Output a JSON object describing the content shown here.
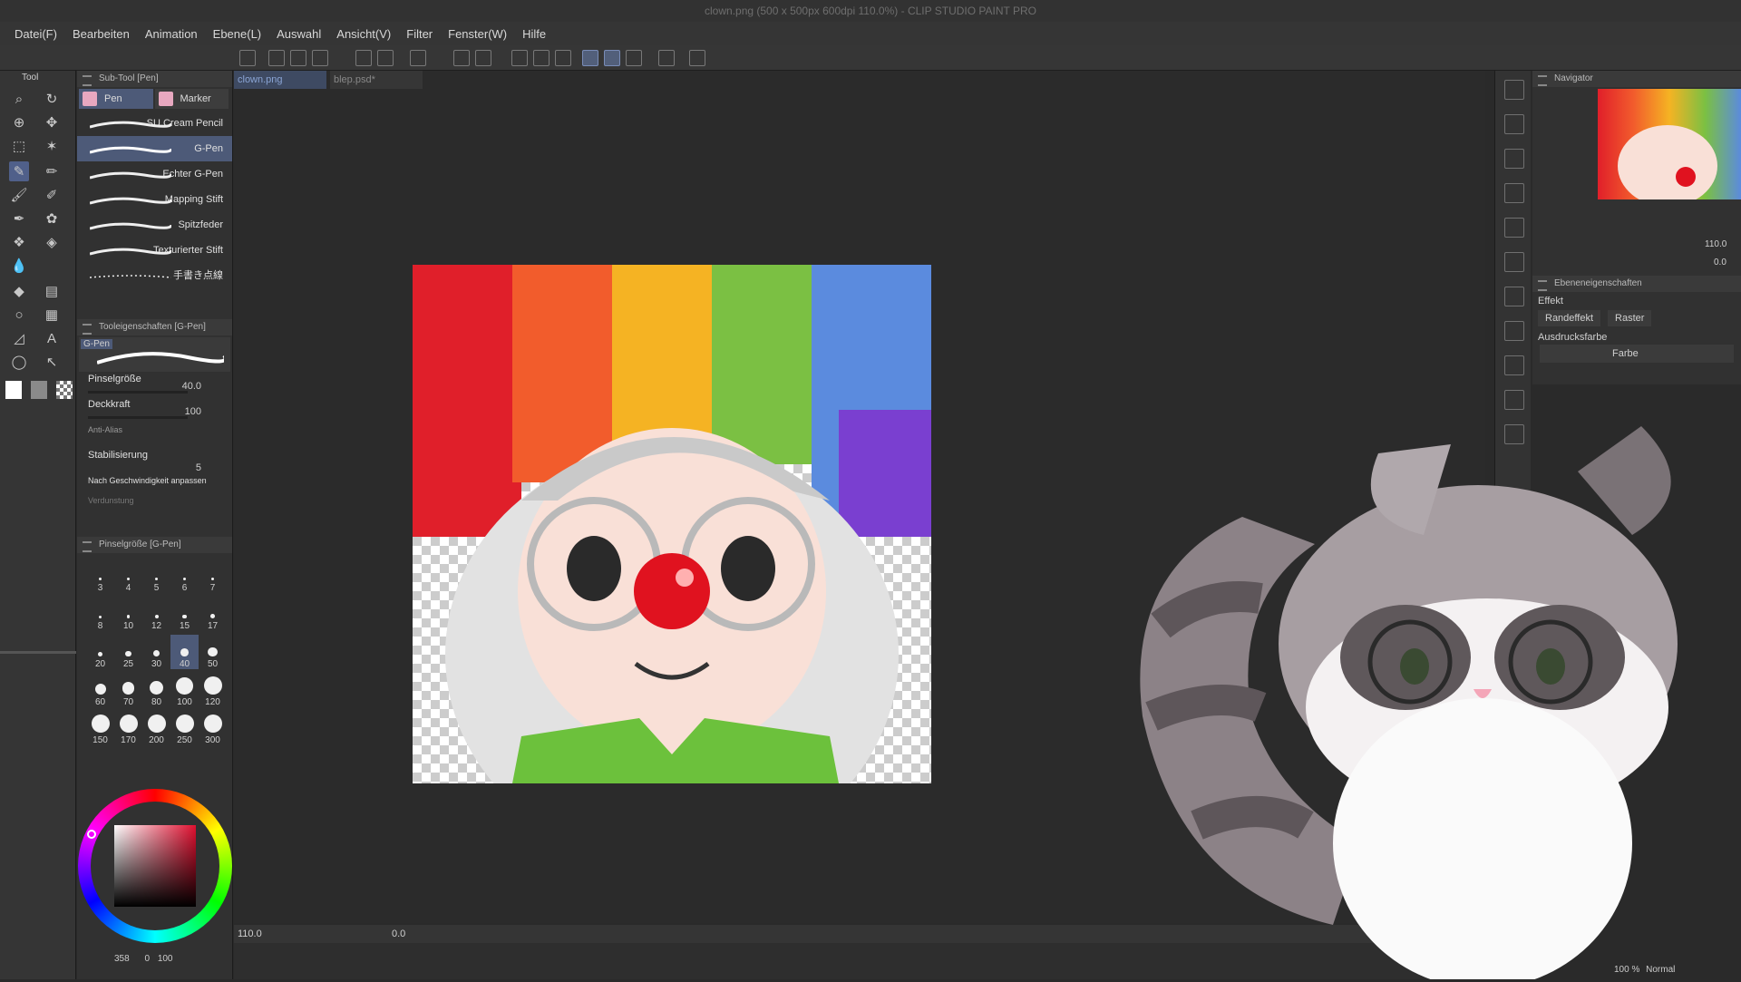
{
  "titlebar": {
    "title": "clown.png (500 x 500px 600dpi 110.0%) - CLIP STUDIO PAINT PRO"
  },
  "menu": [
    "Datei(F)",
    "Bearbeiten",
    "Animation",
    "Ebene(L)",
    "Auswahl",
    "Ansicht(V)",
    "Filter",
    "Fenster(W)",
    "Hilfe"
  ],
  "tool_panel": {
    "tab": "Tool"
  },
  "subtool": {
    "header": "Sub-Tool [Pen]",
    "groups": [
      "Pen",
      "Marker"
    ],
    "brushes": [
      "SU Cream Pencil",
      "G-Pen",
      "Echter G-Pen",
      "Mapping Stift",
      "Spitzfeder",
      "Texturierter Stift",
      "手書き点線"
    ],
    "selected": "G-Pen"
  },
  "tool_props": {
    "header": "Tooleigenschaften [G-Pen]",
    "preview_label": "G-Pen",
    "brush_size_label": "Pinselgröße",
    "brush_size": "40.0",
    "opacity_label": "Deckkraft",
    "opacity": "100",
    "antialias_label": "Anti-Alias",
    "stabilization_label": "Stabilisierung",
    "stabilization": "5",
    "speed_label": "Nach Geschwindigkeit anpassen",
    "faded_label": "Verdunstung"
  },
  "brush_sizes": {
    "header": "Pinselgröße [G-Pen]",
    "values": [
      "3",
      "4",
      "5",
      "6",
      "7",
      "8",
      "10",
      "12",
      "15",
      "17",
      "20",
      "25",
      "30",
      "40",
      "50",
      "60",
      "70",
      "80",
      "100",
      "120",
      "150",
      "170",
      "200",
      "250",
      "300"
    ],
    "selected": "40"
  },
  "document_tabs": [
    {
      "name": "clown.png",
      "active": true
    },
    {
      "name": "blep.psd*",
      "active": false
    }
  ],
  "statusbar": {
    "zoom": "110.0",
    "rotate": "0.0"
  },
  "navigator": {
    "title": "Navigator",
    "zoom": "110.0",
    "rotate": "0.0"
  },
  "layer_props": {
    "title": "Ebeneneigenschaften",
    "effect_label": "Effekt",
    "border_effect": "Randeffekt",
    "raster": "Raster",
    "expression_color_label": "Ausdrucksfarbe",
    "color_option": "Farbe"
  },
  "layer_footer": {
    "mode": "Normal",
    "opacity": "100 %"
  },
  "color_footer": {
    "a": "358",
    "b": "0",
    "c": "100"
  },
  "colors": {
    "accent": "#4d5a78",
    "bg": "#2b2b2b",
    "panel": "#313131",
    "selected_hue": "#e01030"
  }
}
